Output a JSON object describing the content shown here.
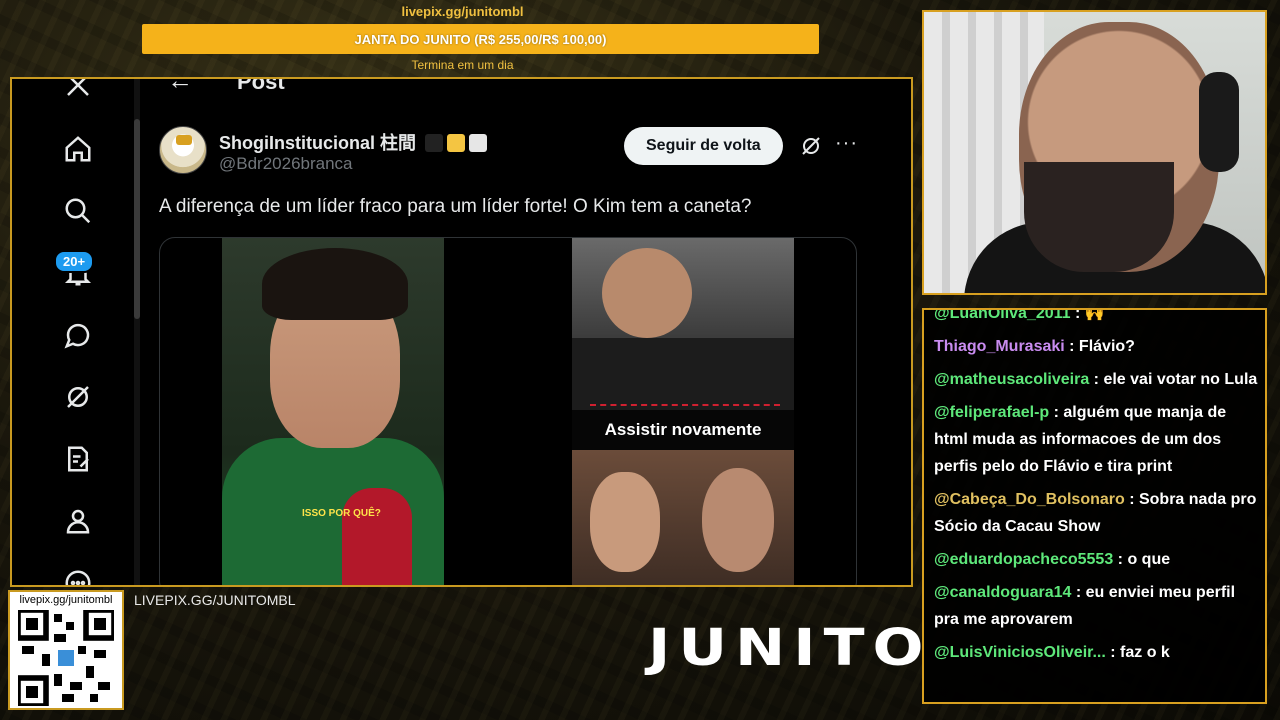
{
  "goal": {
    "url": "livepix.gg/junitombl",
    "title": "JANTA DO JUNITO (R$ 255,00/R$ 100,00)",
    "ends": "Termina em um dia",
    "bar_color": "#f5b21a"
  },
  "x_app": {
    "page_title": "Post",
    "notif_count": "20+",
    "nav_icons": [
      "x-logo-icon",
      "home-icon",
      "search-icon",
      "notifications-icon",
      "messages-icon",
      "grok-icon",
      "lists-icon",
      "profile-icon",
      "more-icon"
    ],
    "post": {
      "author_name": "ShogiInstitucional 柱間",
      "author_handle": "@Bdr2026branca",
      "follow_label": "Seguir de volta",
      "text": "A diferença de um líder fraco para um líder forte! O Kim tem a caneta?",
      "replay_label": "Assistir novamente",
      "mic_caption": "ISSO POR QUÊ?"
    }
  },
  "pix": {
    "qr_label": "livepix.gg/junitombl",
    "url_text": "LIVEPIX.GG/JUNITOMBL"
  },
  "brand": "JUNITO",
  "chat": {
    "messages": [
      {
        "user": "@LuanOliva_2011",
        "text": ": 🙌",
        "color": "#5ee87a"
      },
      {
        "user": "Thiago_Murasaki",
        "text": ": Flávio?",
        "color": "#c98cf0"
      },
      {
        "user": "@matheusacoliveira",
        "text": ": ele vai votar no Lula",
        "color": "#5ee87a"
      },
      {
        "user": "@feliperafael-p",
        "text": ": alguém que manja de html muda as informacoes de um dos perfis pelo do Flávio e tira print",
        "color": "#5ee87a"
      },
      {
        "user": "@Cabeça_Do_Bolsonaro",
        "text": ": Sobra nada pro Sócio da Cacau Show",
        "color": "#e0c060"
      },
      {
        "user": "@eduardopacheco5553",
        "text": ": o que",
        "color": "#5ee87a"
      },
      {
        "user": "@canaldoguara14",
        "text": ": eu enviei meu perfil pra me aprovarem",
        "color": "#5ee87a"
      },
      {
        "user": "@LuisViniciosOliveir...",
        "text": ": faz o k",
        "color": "#5ee87a"
      }
    ]
  },
  "colors": {
    "frame": "#c99a20",
    "x_blue": "#1d9bf0"
  }
}
